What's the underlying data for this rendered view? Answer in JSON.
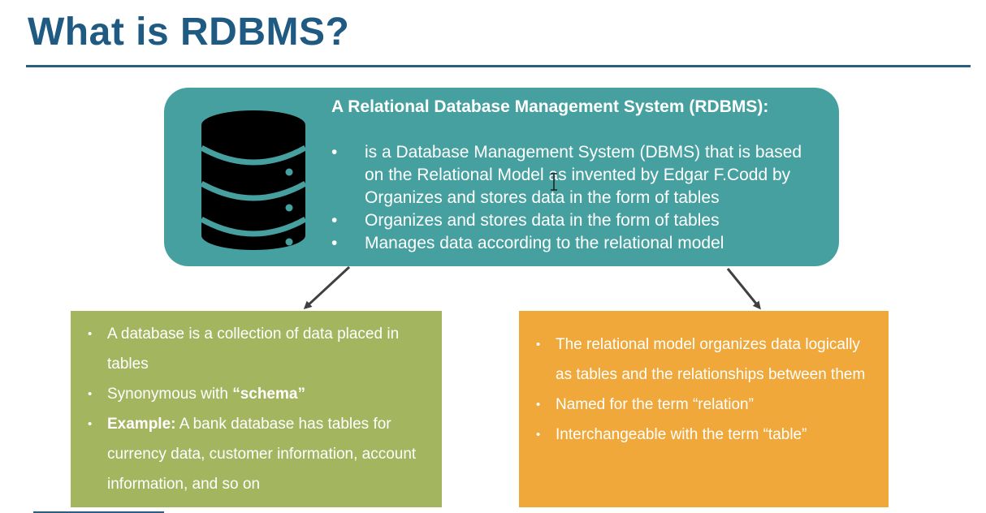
{
  "slide": {
    "title": "What is RDBMS?"
  },
  "definition": {
    "heading": "A Relational Database Management System (RDBMS):",
    "bullets": [
      "is a Database Management System (DBMS) that is based on the Relational Model as invented by Edgar F.Codd by Organizes and stores data in the form of tables",
      "Organizes and stores data in the form of tables",
      "Manages data according to the relational model"
    ],
    "icon": "database-icon"
  },
  "database_card": {
    "bullet_1": "A database is a collection of data placed in tables",
    "bullet_2_prefix": "Synonymous with ",
    "bullet_2_bold": "“schema”",
    "bullet_3_bold": "Example:",
    "bullet_3_rest": " A bank database has tables for currency data, customer information, account information, and so on"
  },
  "model_card": {
    "bullets": [
      "The relational model organizes data logically as tables and the relationships between them",
      "Named for the term “relation”",
      "Interchangeable with the term “table”"
    ]
  },
  "colors": {
    "title": "#1f5a83",
    "teal": "#47a0a0",
    "green": "#a4b560",
    "orange": "#efa839",
    "database_icon": "#000000",
    "database_stripes": "#47a0a0"
  }
}
